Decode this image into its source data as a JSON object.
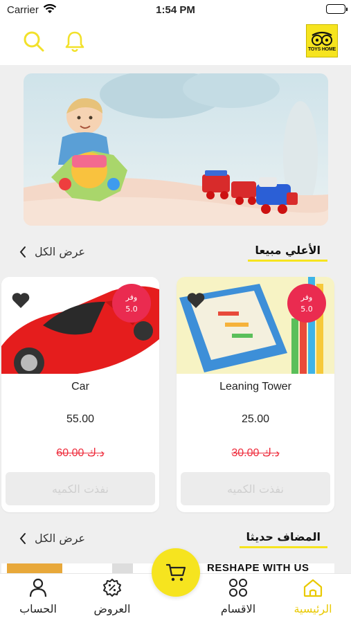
{
  "status_bar": {
    "carrier": "Carrier",
    "time": "1:54 PM"
  },
  "header": {
    "logo_text": "TOYS HOME"
  },
  "sections": {
    "best_selling": {
      "title": "الأعلي مبيعا",
      "view_all": "عرض الكل"
    },
    "new_arrivals": {
      "title": "المضاف حديثا",
      "view_all": "عرض الكل"
    }
  },
  "products": [
    {
      "name": "Car",
      "price": "55.00",
      "old_price": "60.00 د.ك",
      "discount_label": "وفر",
      "discount_value": "5.0",
      "button": "نفذت الكميه"
    },
    {
      "name": "Leaning Tower",
      "price": "25.00",
      "old_price": "30.00 د.ك",
      "discount_label": "وفر",
      "discount_value": "5.0",
      "button": "نفذت الكميه"
    }
  ],
  "peek_text": "RESHAPE WITH US",
  "tabs": [
    {
      "label": "الحساب",
      "icon": "person-icon"
    },
    {
      "label": "العروض",
      "icon": "offers-icon"
    },
    {
      "label": "الاقسام",
      "icon": "grid-icon"
    },
    {
      "label": "الرئيسية",
      "icon": "home-icon"
    }
  ],
  "colors": {
    "accent": "#f6e41f",
    "badge": "#ea2b50",
    "old_price": "#ee2a3a"
  }
}
